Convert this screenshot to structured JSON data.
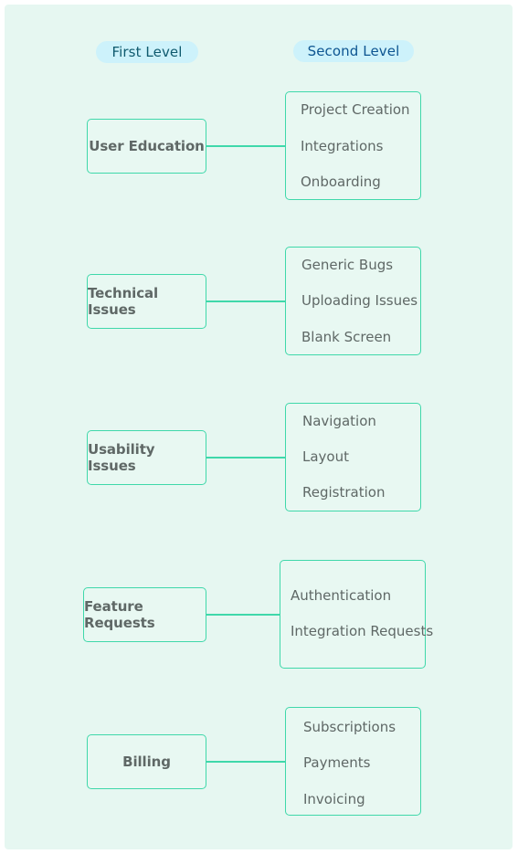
{
  "headers": {
    "first_level": "First Level",
    "second_level": "Second Level"
  },
  "groups": [
    {
      "label": "User Education",
      "children": [
        "Project Creation",
        "Integrations",
        "Onboarding"
      ]
    },
    {
      "label": "Technical Issues",
      "children": [
        "Generic Bugs",
        "Uploading Issues",
        "Blank Screen"
      ]
    },
    {
      "label": "Usability Issues",
      "children": [
        "Navigation",
        "Layout",
        "Registration"
      ]
    },
    {
      "label": "Feature Requests",
      "children": [
        "Authentication",
        "Integration Requests"
      ]
    },
    {
      "label": "Billing",
      "children": [
        "Subscriptions",
        "Payments",
        "Invoicing"
      ]
    }
  ],
  "colors": {
    "panel_bg": "#e6f7f1",
    "node_border": "#3fd8aa",
    "header_bg": "#cdf2fb",
    "text": "#5f6866"
  }
}
